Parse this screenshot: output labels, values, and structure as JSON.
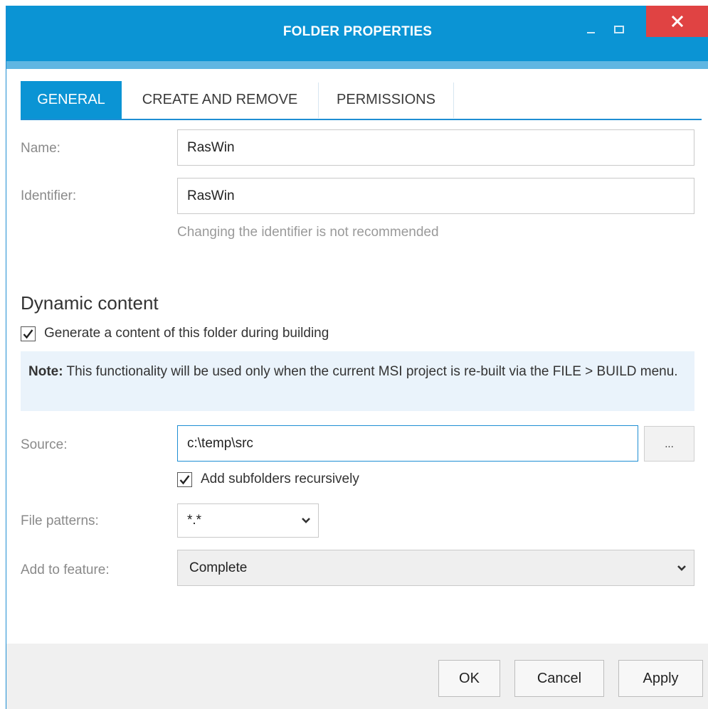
{
  "window": {
    "title": "FOLDER PROPERTIES",
    "close_icon": "close-icon",
    "minimize_icon": "minimize-icon",
    "maximize_icon": "maximize-icon",
    "accent_color": "#0b94d4",
    "close_color": "#e04343"
  },
  "tabs": [
    {
      "label": "GENERAL",
      "active": true
    },
    {
      "label": "CREATE AND REMOVE",
      "active": false
    },
    {
      "label": "PERMISSIONS",
      "active": false
    }
  ],
  "general": {
    "name_label": "Name:",
    "name_value": "RasWin",
    "identifier_label": "Identifier:",
    "identifier_value": "RasWin",
    "identifier_hint": "Changing the identifier is not recommended"
  },
  "dynamic": {
    "section_title": "Dynamic content",
    "generate_label": "Generate a content of this folder during building",
    "generate_checked": true,
    "note_prefix": "Note:",
    "note_text": " This functionality will be used only when the current MSI project is re-built via the FILE > BUILD menu.",
    "source_label": "Source:",
    "source_value": "c:\\temp\\src",
    "browse_label": "...",
    "recursive_label": "Add subfolders recursively",
    "recursive_checked": true,
    "patterns_label": "File patterns:",
    "patterns_value": "*.*",
    "feature_label": "Add to feature:",
    "feature_value": "Complete"
  },
  "footer": {
    "ok_label": "OK",
    "cancel_label": "Cancel",
    "apply_label": "Apply"
  }
}
